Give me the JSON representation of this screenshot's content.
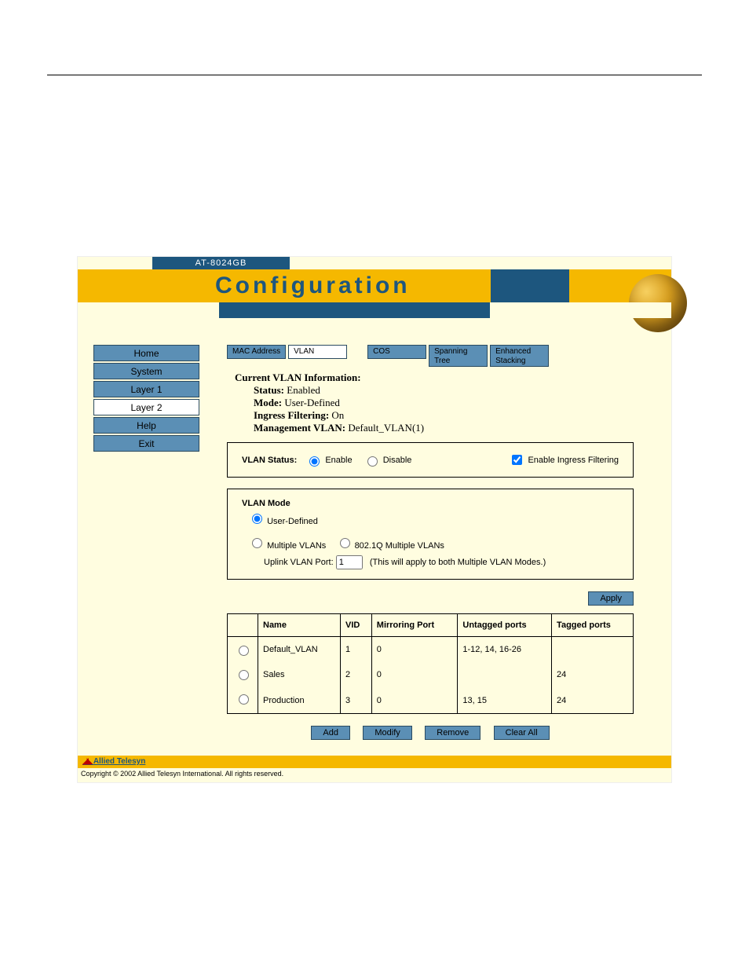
{
  "model": "AT-8024GB",
  "page_title": "Configuration",
  "nav": {
    "items": [
      {
        "label": "Home",
        "active": false
      },
      {
        "label": "System",
        "active": false
      },
      {
        "label": "Layer 1",
        "active": false
      },
      {
        "label": "Layer 2",
        "active": true
      },
      {
        "label": "Help",
        "active": false
      },
      {
        "label": "Exit",
        "active": false
      }
    ]
  },
  "tabs": [
    {
      "label": "MAC Address",
      "active": false,
      "tall": false
    },
    {
      "label": "VLAN",
      "active": true,
      "tall": false
    },
    {
      "label": "COS",
      "active": false,
      "tall": false
    },
    {
      "label": "Spanning Tree",
      "active": false,
      "tall": true
    },
    {
      "label": "Enhanced Stacking",
      "active": false,
      "tall": true
    }
  ],
  "info": {
    "heading": "Current VLAN Information:",
    "status_label": "Status:",
    "status_value": "Enabled",
    "mode_label": "Mode:",
    "mode_value": "User-Defined",
    "ingress_label": "Ingress Filtering:",
    "ingress_value": "On",
    "mgmt_label": "Management VLAN:",
    "mgmt_value": "Default_VLAN(1)"
  },
  "status_panel": {
    "label": "VLAN Status:",
    "enable": "Enable",
    "disable": "Disable",
    "selected": "enable",
    "ingress_checkbox_label": "Enable Ingress Filtering",
    "ingress_checked": true
  },
  "mode_panel": {
    "heading": "VLAN Mode",
    "user_defined": "User-Defined",
    "multiple": "Multiple VLANs",
    "dot1q": "802.1Q Multiple VLANs",
    "selected": "user_defined",
    "uplink_label": "Uplink VLAN Port:",
    "uplink_value": "1",
    "uplink_note": "(This will apply to both Multiple VLAN Modes.)"
  },
  "apply_label": "Apply",
  "table": {
    "headers": {
      "select": "",
      "name": "Name",
      "vid": "VID",
      "mirroring": "Mirroring Port",
      "untagged": "Untagged ports",
      "tagged": "Tagged ports"
    },
    "rows": [
      {
        "name": "Default_VLAN",
        "vid": "1",
        "mirroring": "0",
        "untagged": "1-12, 14, 16-26",
        "tagged": ""
      },
      {
        "name": "Sales",
        "vid": "2",
        "mirroring": "0",
        "untagged": "",
        "tagged": "24"
      },
      {
        "name": "Production",
        "vid": "3",
        "mirroring": "0",
        "untagged": "13, 15",
        "tagged": "24"
      }
    ]
  },
  "table_buttons": {
    "add": "Add",
    "modify": "Modify",
    "remove": "Remove",
    "clear_all": "Clear All"
  },
  "footer": {
    "brand": "Allied Telesyn",
    "copyright": "Copyright © 2002 Allied Telesyn International. All rights reserved."
  }
}
